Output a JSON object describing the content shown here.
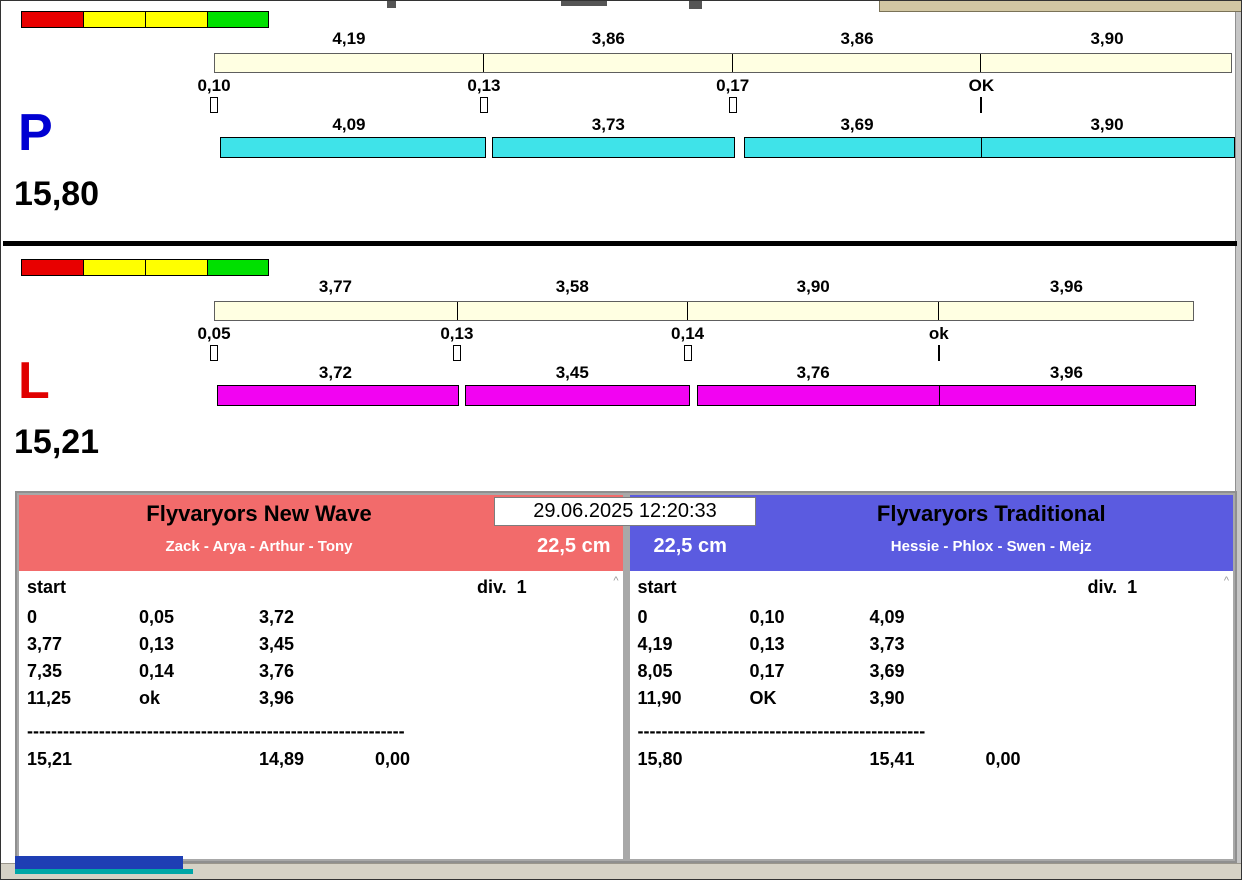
{
  "lanes": [
    {
      "letter": "P",
      "letter_color": "#0000d2",
      "total": "15,80",
      "bar_color": "#3fe3e9",
      "leg_times": [
        "4,19",
        "3,86",
        "3,86",
        "3,90"
      ],
      "change_times": [
        "0,10",
        "0,13",
        "0,17",
        "OK"
      ],
      "run_times": [
        "4,09",
        "3,73",
        "3,69",
        "3,90"
      ]
    },
    {
      "letter": "L",
      "letter_color": "#e00000",
      "total": "15,21",
      "bar_color": "#f203f2",
      "leg_times": [
        "3,77",
        "3,58",
        "3,90",
        "3,96"
      ],
      "change_times": [
        "0,05",
        "0,13",
        "0,14",
        "ok"
      ],
      "run_times": [
        "3,72",
        "3,45",
        "3,76",
        "3,96"
      ]
    }
  ],
  "traffic_lights": [
    "#e80000",
    "#ffff00",
    "#ffff00",
    "#00e000"
  ],
  "results": {
    "datetime": "29.06.2025 12:20:33",
    "scroll_arrow": "^",
    "panels": [
      {
        "team": "Flyvaryors New Wave",
        "members": "Zack - Arya - Arthur - Tony",
        "distance": "22,5 cm",
        "header_color": "#f26b6b",
        "start_label": "start",
        "division_label": "div.  1",
        "rows": [
          {
            "cumulative": "0",
            "change": "0,05",
            "run": "3,72"
          },
          {
            "cumulative": "3,77",
            "change": "0,13",
            "run": "3,45"
          },
          {
            "cumulative": "7,35",
            "change": "0,14",
            "run": "3,76"
          },
          {
            "cumulative": "11,25",
            "change": "ok",
            "run": "3,96"
          }
        ],
        "separator": "---------------------------------------------------------------",
        "total": "15,21",
        "run_sum": "14,89",
        "penalty": "0,00"
      },
      {
        "team": "Flyvaryors Traditional",
        "members": "Hessie - Phlox - Swen - Mejz",
        "distance": "22,5 cm",
        "header_color": "#5b5be0",
        "start_label": "start",
        "division_label": "div.  1",
        "rows": [
          {
            "cumulative": "0",
            "change": "0,10",
            "run": "4,09"
          },
          {
            "cumulative": "4,19",
            "change": "0,13",
            "run": "3,73"
          },
          {
            "cumulative": "8,05",
            "change": "0,17",
            "run": "3,69"
          },
          {
            "cumulative": "11,90",
            "change": "OK",
            "run": "3,90"
          }
        ],
        "separator": "------------------------------------------------",
        "total": "15,80",
        "run_sum": "15,41",
        "penalty": "0,00"
      }
    ]
  }
}
